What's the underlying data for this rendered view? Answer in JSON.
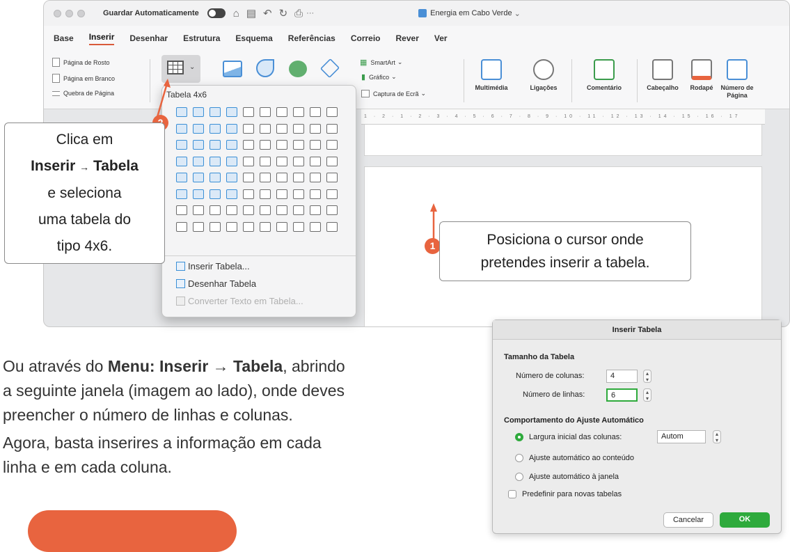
{
  "window": {
    "autosave_label": "Guardar Automaticamente",
    "doc_title": "Energia em Cabo Verde",
    "more": "···"
  },
  "menu": [
    "Base",
    "Inserir",
    "Desenhar",
    "Estrutura",
    "Esquema",
    "Referências",
    "Correio",
    "Rever",
    "Ver"
  ],
  "ribbon": {
    "pages": [
      "Página de Rosto",
      "Página em Branco",
      "Quebra de Página"
    ],
    "smartart": "SmartArt",
    "grafico": "Gráfico",
    "captura": "Captura de Ecrã",
    "multimedia": "Multimédia",
    "ligacoes": "Ligações",
    "comentario": "Comentário",
    "cabecalho": "Cabeçalho",
    "rodape": "Rodapé",
    "numero_pagina": "Número de Página"
  },
  "ruler_text": "1 · 2 · 1 · 2 · 3 · 4 · 5 · 6 · 7 · 8 · 9 · 10 · 11 · 12 · 13 · 14 · 15 · 16 · 17",
  "table_popup": {
    "size_label": "Tabela 4x6",
    "columns": 10,
    "rows": 8,
    "selected_columns": 4,
    "selected_rows": 6,
    "items": [
      {
        "label": "Inserir Tabela...",
        "enabled": true
      },
      {
        "label": "Desenhar Tabela",
        "enabled": true
      },
      {
        "label": "Converter Texto em Tabela...",
        "enabled": false
      }
    ]
  },
  "callout_step2": {
    "badge": "2",
    "line1": "Clica em",
    "bold1": "Inserir",
    "arrow": "→",
    "bold2": "Tabela",
    "line3": "e seleciona",
    "line4": "uma tabela do",
    "line5": "tipo 4x6."
  },
  "callout_step1": {
    "badge": "1",
    "line1": "Posiciona o cursor onde",
    "line2": "pretendes inserir a tabela."
  },
  "body": {
    "p1_pre": "Ou através do ",
    "p1_bold": "Menu: Inserir → Tabela",
    "p1_post": ", abrindo",
    "p1_l2": "a seguinte janela (imagem ao lado), onde deves",
    "p1_l3": "preencher o número de linhas e colunas.",
    "p2_l1": "Agora, basta inserires a informação em cada",
    "p2_l2": "linha e em cada coluna."
  },
  "dialog": {
    "title": "Inserir Tabela",
    "section1": "Tamanho da Tabela",
    "cols_label": "Número de colunas:",
    "cols_value": "4",
    "rows_label": "Número de linhas:",
    "rows_value": "6",
    "section2": "Comportamento do Ajuste Automático",
    "opt1": "Largura inicial das colunas:",
    "opt1_value": "Autom",
    "opt2": "Ajuste automático ao conteúdo",
    "opt3": "Ajuste automático à janela",
    "default_chk": "Predefinir para novas tabelas",
    "cancel": "Cancelar",
    "ok": "OK"
  },
  "colors": {
    "accent": "#e8643f",
    "selection": "#3a8fd6",
    "ok": "#2eaa3c"
  }
}
